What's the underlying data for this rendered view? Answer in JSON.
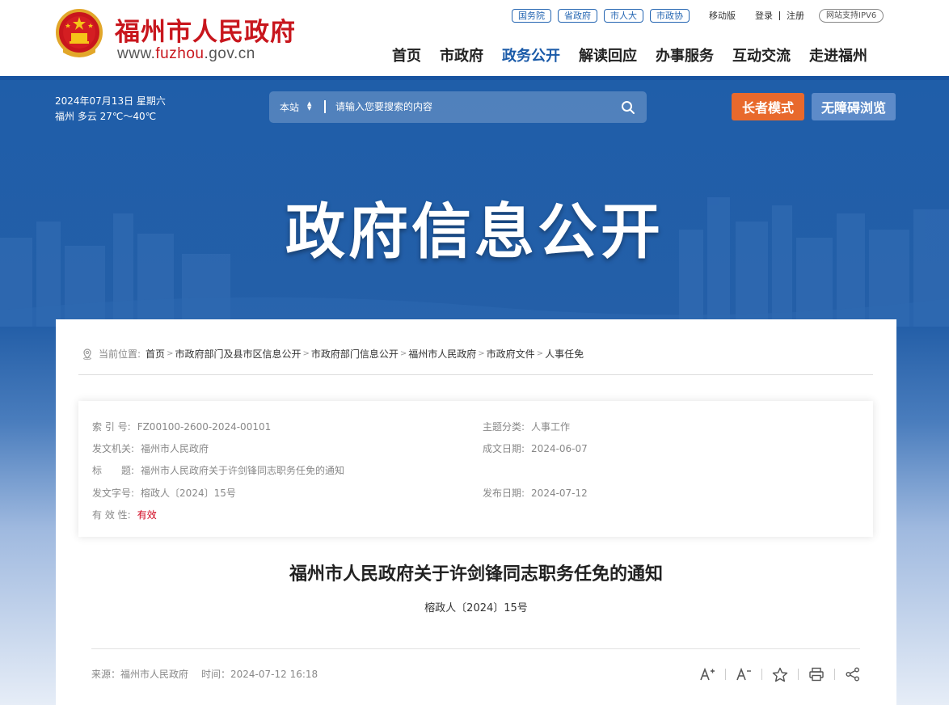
{
  "header": {
    "site_name": "福州市人民政府",
    "url_prefix": "www.",
    "url_domain": "fuzhou",
    "url_suffix": ".gov.cn",
    "top_links": [
      "国务院",
      "省政府",
      "市人大",
      "市政协"
    ],
    "mobile": "移动版",
    "login": "登录",
    "register": "注册",
    "ipv6": "网站支持IPV6",
    "nav": [
      "首页",
      "市政府",
      "政务公开",
      "解读回应",
      "办事服务",
      "互动交流",
      "走进福州"
    ]
  },
  "toolbar": {
    "date": "2024年07月13日 星期六",
    "weather": "福州 多云 27℃～40℃",
    "search_scope": "本站",
    "search_placeholder": "请输入您要搜索的内容",
    "elder_mode": "长者模式",
    "accessible": "无障碍浏览"
  },
  "banner": {
    "title": "政府信息公开"
  },
  "breadcrumb": {
    "prefix": "当前位置:",
    "items": [
      "首页",
      "市政府部门及县市区信息公开",
      "市政府部门信息公开",
      "福州市人民政府",
      "市政府文件",
      "人事任免"
    ]
  },
  "meta": {
    "index_label": "索 引 号:",
    "index_value": "FZ00100-2600-2024-00101",
    "topic_label": "主题分类:",
    "topic_value": "人事工作",
    "issuer_label": "发文机关:",
    "issuer_value": "福州市人民政府",
    "created_label": "成文日期:",
    "created_value": "2024-06-07",
    "title_label": "标　　题:",
    "title_value": "福州市人民政府关于许剑锋同志职务任免的通知",
    "docno_label": "发文字号:",
    "docno_value": "榕政人〔2024〕15号",
    "published_label": "发布日期:",
    "published_value": "2024-07-12",
    "validity_label": "有 效 性:",
    "validity_value": "有效"
  },
  "document": {
    "title": "福州市人民政府关于许剑锋同志职务任免的通知",
    "number": "榕政人〔2024〕15号",
    "source": "来源：福州市人民政府",
    "time": "时间：2024-07-12 16:18"
  },
  "colors": {
    "brand_red": "#c8161d",
    "brand_blue": "#1a5aa8",
    "elder_orange": "#e8692c"
  }
}
